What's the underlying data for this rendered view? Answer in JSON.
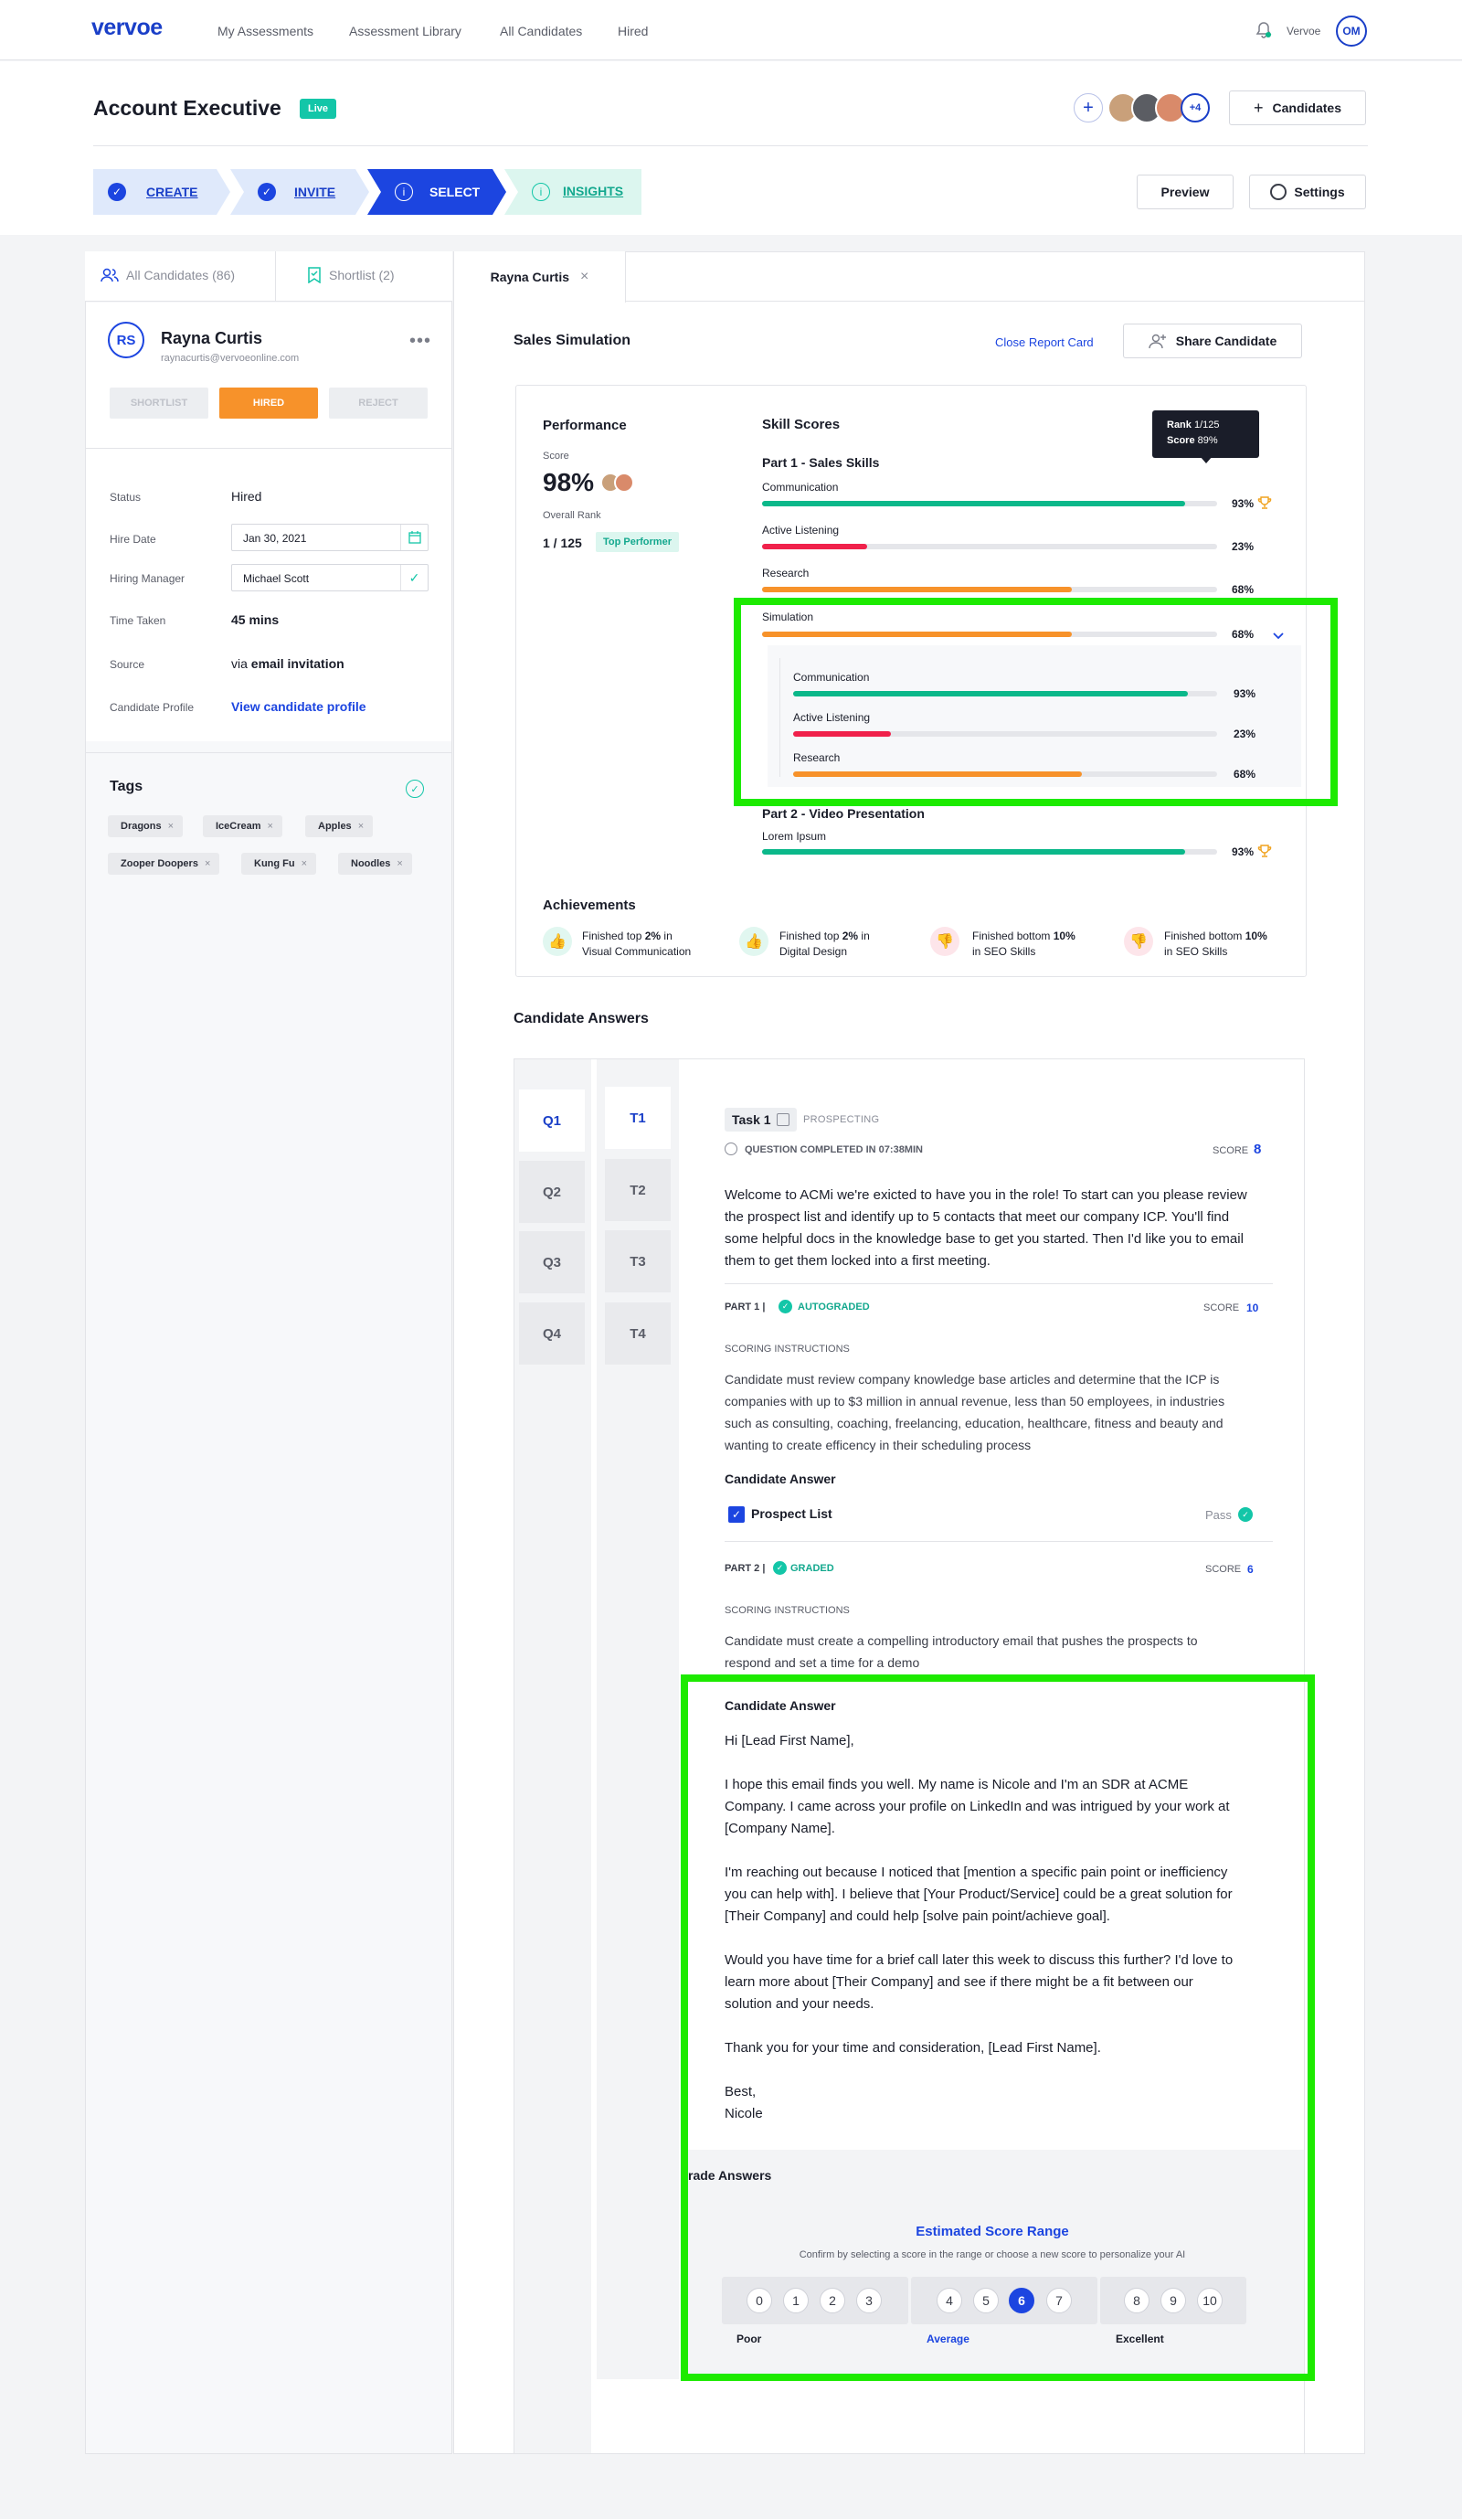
{
  "nav": {
    "logo": "vervoe",
    "links": [
      "My Assessments",
      "Assessment Library",
      "All Candidates",
      "Hired"
    ],
    "user_name": "Vervoe",
    "user_initials": "OM"
  },
  "header": {
    "title": "Account Executive",
    "status_badge": "Live",
    "avatar_more": "+4",
    "candidates_button": "Candidates"
  },
  "steps": {
    "create": "CREATE",
    "invite": "INVITE",
    "select": "SELECT",
    "insights": "INSIGHTS",
    "preview_button": "Preview",
    "settings_button": "Settings"
  },
  "left": {
    "tab_all": "All Candidates (86)",
    "tab_shortlist": "Shortlist (2)",
    "candidate": {
      "initials": "RS",
      "name": "Rayna Curtis",
      "email": "raynacurtis@vervoeonline.com",
      "actions": [
        "SHORTLIST",
        "HIRED",
        "REJECT"
      ]
    },
    "fields": {
      "status_label": "Status",
      "status_value": "Hired",
      "hire_date_label": "Hire Date",
      "hire_date_value": "Jan 30, 2021",
      "manager_label": "Hiring Manager",
      "manager_value": "Michael Scott",
      "time_label": "Time Taken",
      "time_value": "45 mins",
      "source_label": "Source",
      "source_prefix": "via",
      "source_value": "email invitation",
      "profile_label": "Candidate Profile",
      "profile_link": "View candidate profile"
    },
    "tags_title": "Tags",
    "tags": [
      "Dragons",
      "IceCream",
      "Apples",
      "Zooper Doopers",
      "Kung Fu",
      "Noodles"
    ]
  },
  "report": {
    "tab_label": "Rayna Curtis",
    "section_title": "Sales Simulation",
    "close_link": "Close Report Card",
    "share_button": "Share Candidate",
    "performance_title": "Performance",
    "score_label": "Score",
    "score_value": "98%",
    "overall_rank_label": "Overall Rank",
    "overall_rank_value": "1 / 125",
    "top_performer": "Top Performer",
    "skill_scores_title": "Skill Scores",
    "tooltip_rank_label": "Rank",
    "tooltip_rank_value": "1/125",
    "tooltip_score_label": "Score",
    "tooltip_score_value": "89%",
    "part1_title": "Part 1 - Sales Skills",
    "skills": [
      {
        "name": "Communication",
        "pct": "93%",
        "value": 0.93,
        "color": "#0bb88a"
      },
      {
        "name": "Active Listening",
        "pct": "23%",
        "value": 0.23,
        "color": "#f0214b"
      },
      {
        "name": "Research",
        "pct": "68%",
        "value": 0.68,
        "color": "#f7922a"
      },
      {
        "name": "Simulation",
        "pct": "68%",
        "value": 0.68,
        "color": "#f7922a"
      }
    ],
    "subskills": [
      {
        "name": "Communication",
        "pct": "93%",
        "value": 0.93,
        "color": "#0bb88a"
      },
      {
        "name": "Active Listening",
        "pct": "23%",
        "value": 0.23,
        "color": "#f0214b"
      },
      {
        "name": "Research",
        "pct": "68%",
        "value": 0.68,
        "color": "#f7922a"
      }
    ],
    "part2_title": "Part 2 - Video Presentation",
    "part2_skill": {
      "name": "Lorem Ipsum",
      "pct": "93%",
      "value": 0.93,
      "color": "#0bb88a"
    },
    "achievements_title": "Achievements",
    "achievements": [
      {
        "l1a": "Finished top ",
        "l1b": "2%",
        "l1c": " in",
        "l2": "Visual Communication",
        "type": "up"
      },
      {
        "l1a": "Finished top ",
        "l1b": "2%",
        "l1c": " in",
        "l2": "Digital Design",
        "type": "up"
      },
      {
        "l1a": "Finished bottom ",
        "l1b": "10%",
        "l1c": "",
        "l2": "in SEO Skills",
        "type": "down"
      },
      {
        "l1a": "Finished bottom ",
        "l1b": "10%",
        "l1c": "",
        "l2": "in SEO Skills",
        "type": "down"
      }
    ]
  },
  "answers": {
    "title": "Candidate Answers",
    "questions": [
      "Q1",
      "Q2",
      "Q3",
      "Q4"
    ],
    "tasks": [
      "T1",
      "T2",
      "T3",
      "T4"
    ],
    "task_badge": "Task 1",
    "task_category": "PROSPECTING",
    "completed_text": "QUESTION COMPLETED IN 07:38MIN",
    "score_label": "SCORE",
    "score_value": "8",
    "prompt_lines": [
      "Welcome to ACMi we're exicted to have you in the role! To start can you please review",
      "the prospect list and identify up to 5 contacts that meet our company ICP. You'll find",
      "some helpful docs in the knowledge base to get you started. Then I'd like you to email",
      "them to get them locked into a first meeting."
    ],
    "part1_label": "PART 1 |",
    "part1_status": "AUTOGRADED",
    "part1_score": "10",
    "scoring_instructions_label": "SCORING INSTRUCTIONS",
    "part1_instructions": [
      "Candidate must review company knowledge base articles and determine that the ICP is",
      "companies with up to $3 million in annual revenue, less than 50 employees, in industries",
      "such as consulting, coaching, freelancing, education, healthcare, fitness and beauty and",
      "wanting to create efficency in their scheduling process"
    ],
    "candidate_answer_label": "Candidate Answer",
    "prospect_list": "Prospect List",
    "pass_label": "Pass",
    "part2_label": "PART 2 |",
    "part2_status": "GRADED",
    "part2_score": "6",
    "part2_instructions": [
      "Candidate must create a compelling introductory email that pushes the prospects to",
      "respond and set a time for a demo"
    ],
    "email": {
      "greeting": "Hi [Lead First Name],",
      "p1": [
        "I hope this email finds you well. My name is Nicole and I'm an SDR at ACME",
        "Company. I came across your profile on LinkedIn and was intrigued by your work at",
        "[Company Name]."
      ],
      "p2": [
        "I'm reaching out because I noticed that [mention a specific pain point or inefficiency",
        "you can help with]. I believe that [Your Product/Service] could be a great solution for",
        "[Their Company] and could help [solve pain point/achieve goal]."
      ],
      "p3": [
        "Would you have time for a brief call later this week to discuss this further? I'd love to",
        "learn more about [Their Company] and see if there might be a fit between our",
        "solution and your needs."
      ],
      "p4": "Thank you for your time and consideration, [Lead First Name].",
      "signoff": "Best,",
      "name": "Nicole"
    },
    "grade_title": "rade Answers",
    "estimated_title": "Estimated Score Range",
    "estimated_sub": "Confirm by selecting a score in the range or choose a new score to personalize your AI",
    "scores": [
      "0",
      "1",
      "2",
      "3",
      "4",
      "5",
      "6",
      "7",
      "8",
      "9",
      "10"
    ],
    "selected_score": "6",
    "scale_labels": [
      "Poor",
      "Average",
      "Excellent"
    ]
  }
}
